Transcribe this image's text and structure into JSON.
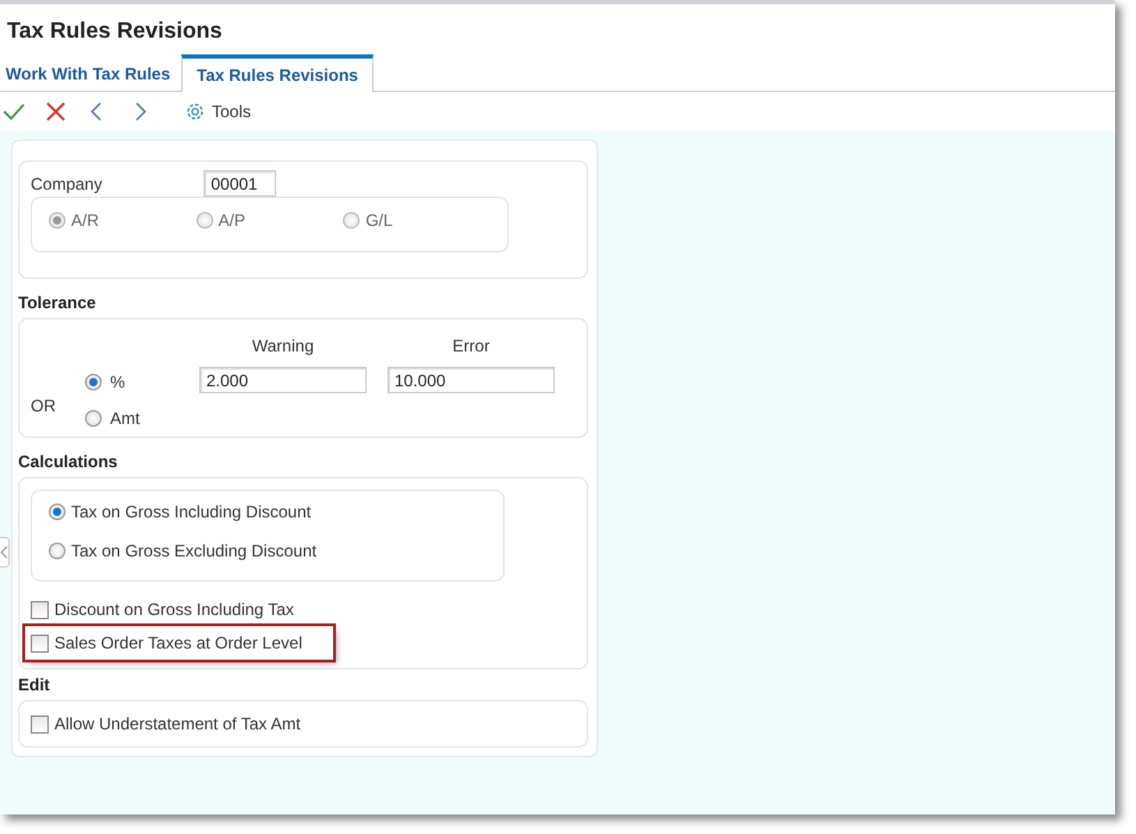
{
  "window": {
    "title": "Tax Rules Revisions"
  },
  "tabs": [
    {
      "label": "Work With Tax Rules",
      "selected": false
    },
    {
      "label": "Tax Rules Revisions",
      "selected": true
    }
  ],
  "toolbar": [
    {
      "kind": "ok"
    },
    {
      "kind": "cancel"
    },
    {
      "kind": "previous"
    },
    {
      "kind": "next"
    },
    {
      "kind": "tools",
      "label": "Tools"
    }
  ],
  "company": {
    "label": "Company",
    "value": "00001",
    "options": [
      {
        "label": "A/R",
        "selected": true,
        "disabled": true
      },
      {
        "label": "A/P",
        "selected": false,
        "disabled": true
      },
      {
        "label": "G/L",
        "selected": false,
        "disabled": true
      }
    ]
  },
  "tolerance": {
    "heading": "Tolerance",
    "or_label": "OR",
    "modes": [
      {
        "label": "%",
        "selected": true
      },
      {
        "label": "Amt",
        "selected": false
      }
    ],
    "columns": [
      {
        "label": "Warning",
        "value": "2.000"
      },
      {
        "label": "Error",
        "value": "10.000"
      }
    ]
  },
  "calculations": {
    "heading": "Calculations",
    "methods": [
      {
        "label": "Tax on Gross Including Discount",
        "selected": true
      },
      {
        "label": "Tax on Gross Excluding Discount",
        "selected": false
      }
    ],
    "options": [
      {
        "label": "Discount on Gross Including Tax",
        "checked": false,
        "highlighted": false
      },
      {
        "label": "Sales Order Taxes at Order Level",
        "checked": false,
        "highlighted": true
      }
    ]
  },
  "edit": {
    "heading": "Edit",
    "options": [
      {
        "label": "Allow Understatement of Tax Amt",
        "checked": false,
        "highlighted": false
      }
    ]
  }
}
